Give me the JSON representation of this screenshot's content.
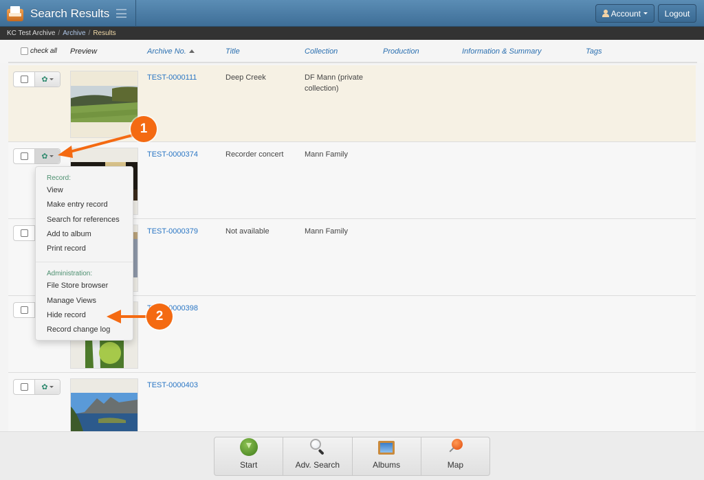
{
  "navbar": {
    "title": "Search Results",
    "account_label": "Account",
    "logout_label": "Logout"
  },
  "breadcrumb": [
    {
      "label": "KC Test Archive"
    },
    {
      "label": "Archive"
    },
    {
      "label": "Results"
    }
  ],
  "table": {
    "check_all_label": "check all",
    "columns": {
      "preview": "Preview",
      "archive_no": "Archive No.",
      "title": "Title",
      "collection": "Collection",
      "production": "Production",
      "information": "Information & Summary",
      "tags": "Tags"
    },
    "sort": {
      "column": "Archive No.",
      "direction": "ascending"
    },
    "rows": [
      {
        "archive_no": "TEST-0000111",
        "title": "Deep Creek",
        "collection": "DF Mann (private collection)",
        "thumb": "grassy-hillside",
        "highlighted": true
      },
      {
        "archive_no": "TEST-0000374",
        "title": "Recorder concert",
        "collection": "Mann Family",
        "thumb": "concert",
        "highlighted": false
      },
      {
        "archive_no": "TEST-0000379",
        "title": "Not available",
        "collection": "Mann Family",
        "thumb": "sepia",
        "highlighted": false
      },
      {
        "archive_no": "TEST-0000398",
        "title": "",
        "collection": "",
        "thumb": "waterfall",
        "highlighted": false
      },
      {
        "archive_no": "TEST-0000403",
        "title": "",
        "collection": "",
        "thumb": "mountain-lake",
        "highlighted": false
      }
    ]
  },
  "context_menu": {
    "record_group_label": "Record:",
    "record_items": [
      "View",
      "Make entry record",
      "Search for references",
      "Add to album",
      "Print record"
    ],
    "admin_group_label": "Administration:",
    "admin_items": [
      "File Store browser",
      "Manage Views",
      "Hide record",
      "Record change log"
    ]
  },
  "annotations": [
    {
      "number": "1",
      "points_to": "row-2 gear dropdown button"
    },
    {
      "number": "2",
      "points_to": "Hide record"
    }
  ],
  "toolbar": {
    "buttons": [
      {
        "label": "Start",
        "icon": "start-icon"
      },
      {
        "label": "Adv. Search",
        "icon": "search-icon"
      },
      {
        "label": "Albums",
        "icon": "albums-icon"
      },
      {
        "label": "Map",
        "icon": "map-pin-icon"
      }
    ]
  },
  "colors": {
    "navbar": "#4a7ba4",
    "link": "#2a76c4",
    "highlight_row": "#f6f1e4",
    "annotation": "#f46a12",
    "menu_group_label": "#4c8f6f"
  }
}
